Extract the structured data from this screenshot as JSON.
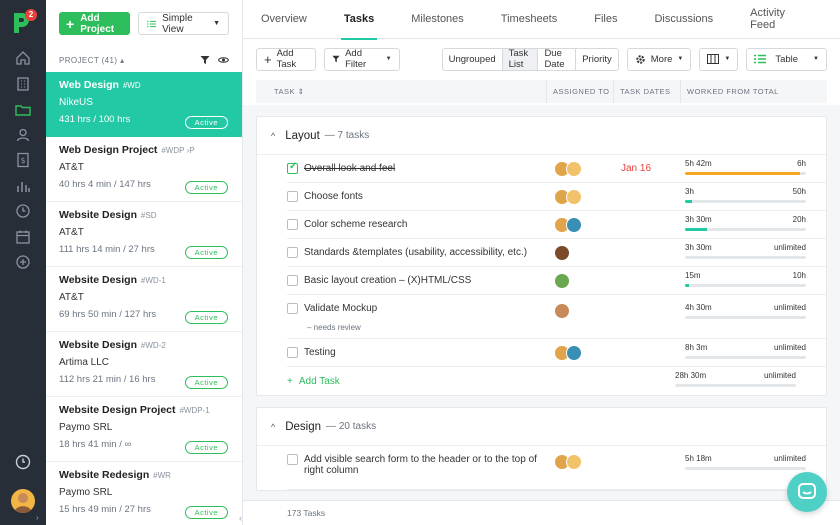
{
  "app": {
    "logo_badge": "2",
    "rail_icons": [
      "home-icon",
      "building-icon",
      "folder-icon",
      "user-icon",
      "invoice-icon",
      "chart-icon",
      "clock-icon",
      "calendar-icon",
      "plus-circle-icon",
      "timer-icon"
    ],
    "accent": "#23c8a5",
    "green": "#2dbd5a"
  },
  "sidebar": {
    "add_project": "Add Project",
    "view_label": "Simple View",
    "header": "PROJECT (41) ▴",
    "projects": [
      {
        "name": "Web Design",
        "code": "#WD",
        "client": "NikeUS",
        "hours": "431 hrs / 100 hrs",
        "status": "Active"
      },
      {
        "name": "Web Design Project",
        "code": "#WDP ›P",
        "client": "AT&T",
        "hours": "40 hrs 4 min / 147 hrs",
        "status": "Active"
      },
      {
        "name": "Website Design",
        "code": "#SD",
        "client": "AT&T",
        "hours": "111 hrs 14 min / 27 hrs",
        "status": "Active"
      },
      {
        "name": "Website Design",
        "code": "#WD-1",
        "client": "AT&T",
        "hours": "69 hrs 50 min / 127 hrs",
        "status": "Active"
      },
      {
        "name": "Website Design",
        "code": "#WD-2",
        "client": "Artima LLC",
        "hours": "112 hrs 21 min / 16 hrs",
        "status": "Active"
      },
      {
        "name": "Website Design Project",
        "code": "#WDP-1",
        "client": "Paymo SRL",
        "hours": "18 hrs 41 min / ∞",
        "status": "Active"
      },
      {
        "name": "Website Redesign",
        "code": "#WR",
        "client": "Paymo SRL",
        "hours": "15 hrs 49 min / 27 hrs",
        "status": "Active"
      }
    ]
  },
  "tabs": [
    "Overview",
    "Tasks",
    "Milestones",
    "Timesheets",
    "Files",
    "Discussions",
    "Activity Feed"
  ],
  "toolbar": {
    "add_task": "Add Task",
    "add_filter": "Add Filter",
    "segments": [
      "Ungrouped",
      "Task List",
      "Due Date",
      "Priority"
    ],
    "more": "More",
    "table": "Table"
  },
  "table_head": {
    "task": "TASK ⇕",
    "assigned": "ASSIGNED TO",
    "dates": "TASK DATES",
    "worked": "WORKED FROM TOTAL"
  },
  "groups": [
    {
      "title": "Layout",
      "count": "— 7 tasks",
      "tasks": [
        {
          "name": "Overall look and feel",
          "done": true,
          "due": "Jan 16",
          "worked": "5h 42m",
          "total": "6h",
          "progress": 0.95,
          "bar_color": "#f5a623",
          "avatars": [
            "#e0a54a",
            "#f2c26b"
          ]
        },
        {
          "name": "Choose fonts",
          "done": false,
          "due": "",
          "worked": "3h",
          "total": "50h",
          "progress": 0.06,
          "bar_color": "#23c8a5",
          "avatars": [
            "#e0a54a",
            "#f2c26b"
          ]
        },
        {
          "name": "Color scheme research",
          "done": false,
          "due": "",
          "worked": "3h 30m",
          "total": "20h",
          "progress": 0.18,
          "bar_color": "#23c8a5",
          "avatars": [
            "#e0a54a",
            "#3a8fb7"
          ]
        },
        {
          "name": "Standards &templates (usability, accessibility, etc.)",
          "done": false,
          "due": "",
          "worked": "3h 30m",
          "total": "unlimited",
          "progress": 0,
          "bar_color": "#23c8a5",
          "avatars": [
            "#7a4a2a"
          ]
        },
        {
          "name": "Basic layout creation – (X)HTML/CSS",
          "done": false,
          "due": "",
          "worked": "15m",
          "total": "10h",
          "progress": 0.03,
          "bar_color": "#23c8a5",
          "avatars": [
            "#6aa84f"
          ]
        },
        {
          "name": "Validate Mockup",
          "note": "– needs review",
          "done": false,
          "due": "",
          "worked": "4h 30m",
          "total": "unlimited",
          "progress": 0,
          "bar_color": "#23c8a5",
          "avatars": [
            "#c98a5a"
          ]
        },
        {
          "name": "Testing",
          "done": false,
          "due": "",
          "worked": "8h 3m",
          "total": "unlimited",
          "progress": 0,
          "bar_color": "#23c8a5",
          "avatars": [
            "#e0a54a",
            "#3a8fb7"
          ]
        }
      ],
      "add_task": "Add Task",
      "sum_worked": "28h 30m",
      "sum_total": "unlimited"
    },
    {
      "title": "Design",
      "count": "— 20 tasks",
      "tasks": [
        {
          "name": "Add visible search form to the header or to the top of right column",
          "done": false,
          "due": "",
          "worked": "5h 18m",
          "total": "unlimited",
          "progress": 0,
          "bar_color": "#23c8a5",
          "avatars": [
            "#e0a54a",
            "#f2c26b"
          ]
        }
      ]
    }
  ],
  "footer": {
    "count": "173 Tasks"
  }
}
